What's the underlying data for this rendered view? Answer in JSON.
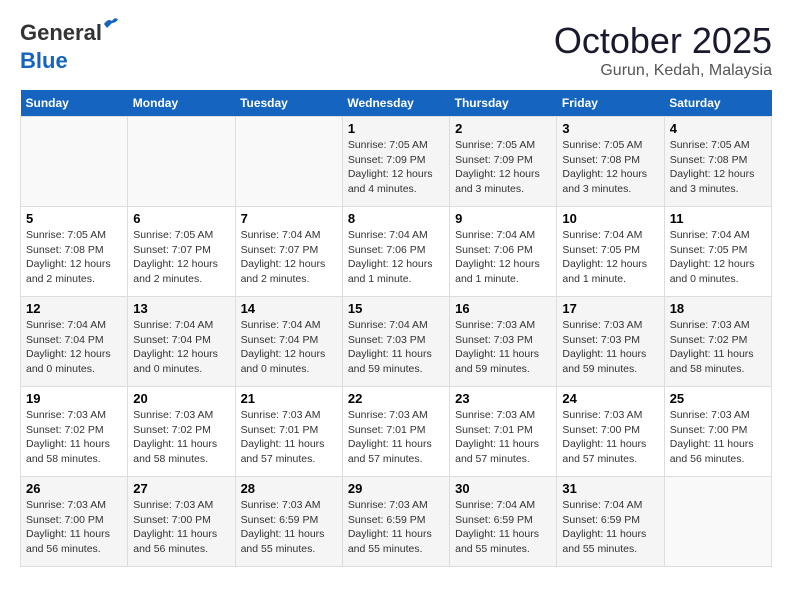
{
  "header": {
    "logo_general": "General",
    "logo_blue": "Blue",
    "month": "October 2025",
    "location": "Gurun, Kedah, Malaysia"
  },
  "days_of_week": [
    "Sunday",
    "Monday",
    "Tuesday",
    "Wednesday",
    "Thursday",
    "Friday",
    "Saturday"
  ],
  "weeks": [
    [
      {
        "day": "",
        "content": ""
      },
      {
        "day": "",
        "content": ""
      },
      {
        "day": "",
        "content": ""
      },
      {
        "day": "1",
        "content": "Sunrise: 7:05 AM\nSunset: 7:09 PM\nDaylight: 12 hours\nand 4 minutes."
      },
      {
        "day": "2",
        "content": "Sunrise: 7:05 AM\nSunset: 7:09 PM\nDaylight: 12 hours\nand 3 minutes."
      },
      {
        "day": "3",
        "content": "Sunrise: 7:05 AM\nSunset: 7:08 PM\nDaylight: 12 hours\nand 3 minutes."
      },
      {
        "day": "4",
        "content": "Sunrise: 7:05 AM\nSunset: 7:08 PM\nDaylight: 12 hours\nand 3 minutes."
      }
    ],
    [
      {
        "day": "5",
        "content": "Sunrise: 7:05 AM\nSunset: 7:08 PM\nDaylight: 12 hours\nand 2 minutes."
      },
      {
        "day": "6",
        "content": "Sunrise: 7:05 AM\nSunset: 7:07 PM\nDaylight: 12 hours\nand 2 minutes."
      },
      {
        "day": "7",
        "content": "Sunrise: 7:04 AM\nSunset: 7:07 PM\nDaylight: 12 hours\nand 2 minutes."
      },
      {
        "day": "8",
        "content": "Sunrise: 7:04 AM\nSunset: 7:06 PM\nDaylight: 12 hours\nand 1 minute."
      },
      {
        "day": "9",
        "content": "Sunrise: 7:04 AM\nSunset: 7:06 PM\nDaylight: 12 hours\nand 1 minute."
      },
      {
        "day": "10",
        "content": "Sunrise: 7:04 AM\nSunset: 7:05 PM\nDaylight: 12 hours\nand 1 minute."
      },
      {
        "day": "11",
        "content": "Sunrise: 7:04 AM\nSunset: 7:05 PM\nDaylight: 12 hours\nand 0 minutes."
      }
    ],
    [
      {
        "day": "12",
        "content": "Sunrise: 7:04 AM\nSunset: 7:04 PM\nDaylight: 12 hours\nand 0 minutes."
      },
      {
        "day": "13",
        "content": "Sunrise: 7:04 AM\nSunset: 7:04 PM\nDaylight: 12 hours\nand 0 minutes."
      },
      {
        "day": "14",
        "content": "Sunrise: 7:04 AM\nSunset: 7:04 PM\nDaylight: 12 hours\nand 0 minutes."
      },
      {
        "day": "15",
        "content": "Sunrise: 7:04 AM\nSunset: 7:03 PM\nDaylight: 11 hours\nand 59 minutes."
      },
      {
        "day": "16",
        "content": "Sunrise: 7:03 AM\nSunset: 7:03 PM\nDaylight: 11 hours\nand 59 minutes."
      },
      {
        "day": "17",
        "content": "Sunrise: 7:03 AM\nSunset: 7:03 PM\nDaylight: 11 hours\nand 59 minutes."
      },
      {
        "day": "18",
        "content": "Sunrise: 7:03 AM\nSunset: 7:02 PM\nDaylight: 11 hours\nand 58 minutes."
      }
    ],
    [
      {
        "day": "19",
        "content": "Sunrise: 7:03 AM\nSunset: 7:02 PM\nDaylight: 11 hours\nand 58 minutes."
      },
      {
        "day": "20",
        "content": "Sunrise: 7:03 AM\nSunset: 7:02 PM\nDaylight: 11 hours\nand 58 minutes."
      },
      {
        "day": "21",
        "content": "Sunrise: 7:03 AM\nSunset: 7:01 PM\nDaylight: 11 hours\nand 57 minutes."
      },
      {
        "day": "22",
        "content": "Sunrise: 7:03 AM\nSunset: 7:01 PM\nDaylight: 11 hours\nand 57 minutes."
      },
      {
        "day": "23",
        "content": "Sunrise: 7:03 AM\nSunset: 7:01 PM\nDaylight: 11 hours\nand 57 minutes."
      },
      {
        "day": "24",
        "content": "Sunrise: 7:03 AM\nSunset: 7:00 PM\nDaylight: 11 hours\nand 57 minutes."
      },
      {
        "day": "25",
        "content": "Sunrise: 7:03 AM\nSunset: 7:00 PM\nDaylight: 11 hours\nand 56 minutes."
      }
    ],
    [
      {
        "day": "26",
        "content": "Sunrise: 7:03 AM\nSunset: 7:00 PM\nDaylight: 11 hours\nand 56 minutes."
      },
      {
        "day": "27",
        "content": "Sunrise: 7:03 AM\nSunset: 7:00 PM\nDaylight: 11 hours\nand 56 minutes."
      },
      {
        "day": "28",
        "content": "Sunrise: 7:03 AM\nSunset: 6:59 PM\nDaylight: 11 hours\nand 55 minutes."
      },
      {
        "day": "29",
        "content": "Sunrise: 7:03 AM\nSunset: 6:59 PM\nDaylight: 11 hours\nand 55 minutes."
      },
      {
        "day": "30",
        "content": "Sunrise: 7:04 AM\nSunset: 6:59 PM\nDaylight: 11 hours\nand 55 minutes."
      },
      {
        "day": "31",
        "content": "Sunrise: 7:04 AM\nSunset: 6:59 PM\nDaylight: 11 hours\nand 55 minutes."
      },
      {
        "day": "",
        "content": ""
      }
    ]
  ]
}
